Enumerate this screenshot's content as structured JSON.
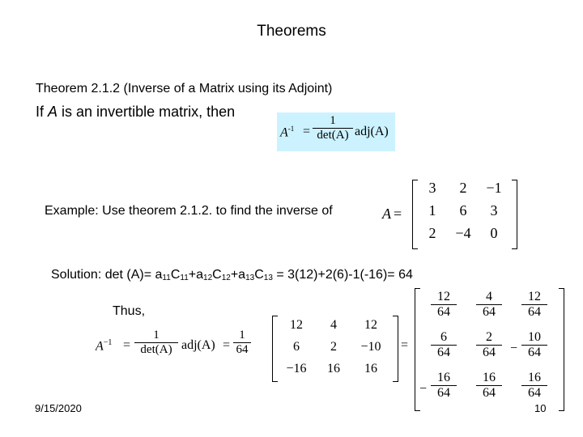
{
  "slide": {
    "title": "Theorems",
    "theorem_heading": "Theorem 2.1.2 (Inverse of a Matrix using its Adjoint)",
    "theorem_statement_prefix": "If ",
    "theorem_statement_var": "A",
    "theorem_statement_suffix": " is an invertible matrix, then",
    "formula": {
      "lhs": "A",
      "lhs_sup": "-1",
      "equals": "=",
      "numerator": "1",
      "denominator": "det(A)",
      "adj": "adj(A)",
      "background": "#ccf2ff"
    },
    "example_text": "Example: Use theorem 2.1.2. to find the inverse of",
    "matrix_A": {
      "label": "A",
      "equals": "=",
      "rows": [
        [
          "3",
          "2",
          "−1"
        ],
        [
          "1",
          "6",
          "3"
        ],
        [
          "2",
          "−4",
          "0"
        ]
      ]
    },
    "solution": {
      "prefix": "Solution: det (A)= ",
      "terms": [
        {
          "a": "a",
          "a_sub": "11",
          "c": "C",
          "c_sub": "11"
        },
        {
          "a": "a",
          "a_sub": "12",
          "c": "C",
          "c_sub": "12"
        },
        {
          "a": "a",
          "a_sub": "13",
          "c": "C",
          "c_sub": "13"
        }
      ],
      "suffix": " = 3(12)+2(6)-1(-16)= 64"
    },
    "thus_text": "Thus,",
    "inverse": {
      "lhs": "A",
      "lhs_sup": "−1",
      "equals1": "=",
      "numerator1": "1",
      "denominator1": "det(A)",
      "adj": "adj(A)",
      "equals2": "=",
      "numerator2": "1",
      "denominator2": "64",
      "adj_matrix": [
        [
          "12",
          "4",
          "12"
        ],
        [
          "6",
          "2",
          "−10"
        ],
        [
          "−16",
          "16",
          "16"
        ]
      ],
      "equals3": "=",
      "result_matrix": [
        [
          {
            "sign": "",
            "num": "12",
            "den": "64"
          },
          {
            "sign": "",
            "num": "4",
            "den": "64"
          },
          {
            "sign": "",
            "num": "12",
            "den": "64"
          }
        ],
        [
          {
            "sign": "",
            "num": "6",
            "den": "64"
          },
          {
            "sign": "",
            "num": "2",
            "den": "64"
          },
          {
            "sign": "−",
            "num": "10",
            "den": "64"
          }
        ],
        [
          {
            "sign": "−",
            "num": "16",
            "den": "64"
          },
          {
            "sign": "",
            "num": "16",
            "den": "64"
          },
          {
            "sign": "",
            "num": "16",
            "den": "64"
          }
        ]
      ]
    },
    "date": "9/15/2020",
    "page_number": "10"
  }
}
